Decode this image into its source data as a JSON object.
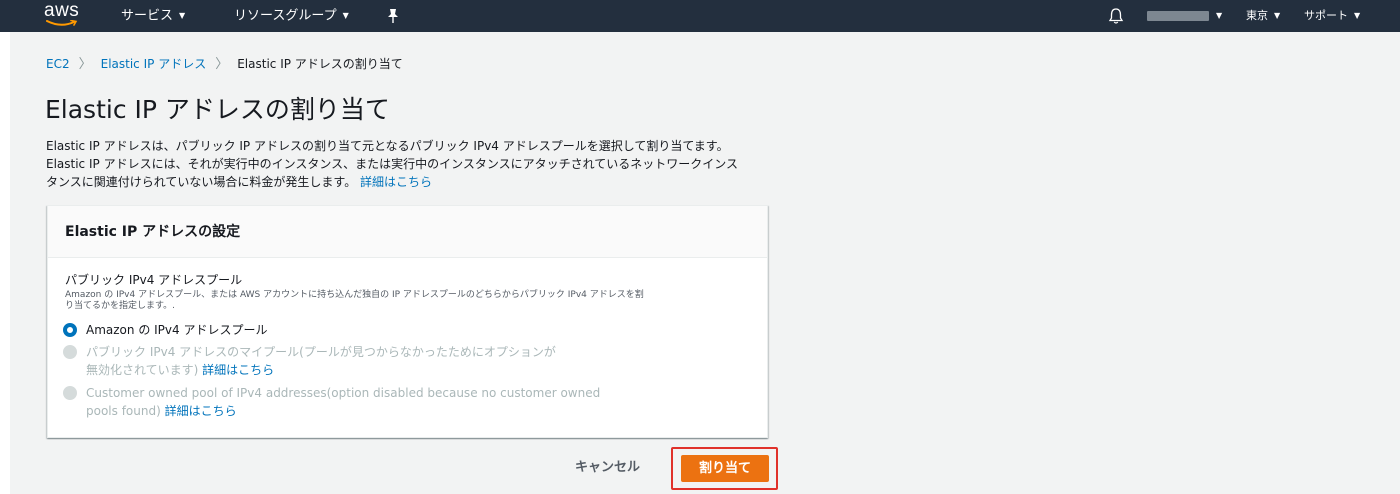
{
  "topnav": {
    "logo_text": "aws",
    "services": "サービス",
    "resource_groups": "リソースグループ",
    "region": "東京",
    "support": "サポート",
    "colors": {
      "background": "#232f3e",
      "text": "#ffffff"
    }
  },
  "breadcrumb": {
    "items": [
      {
        "label": "EC2"
      },
      {
        "label": "Elastic IP アドレス"
      }
    ],
    "current": "Elastic IP アドレスの割り当て"
  },
  "page": {
    "title": "Elastic IP アドレスの割り当て",
    "description": [
      "Elastic IP アドレスは、パブリック IP アドレスの割り当て元となるパブリック IPv4 アドレスプールを選択して割り当てます。",
      "Elastic IP アドレスには、それが実行中のインスタンス、または実行中のインスタンスにアタッチされているネットワークインス",
      "タンスに関連付けられていない場合に料金が発生します。"
    ],
    "description_link": "詳細はこちら"
  },
  "panel": {
    "title": "Elastic IP アドレスの設定",
    "field_label": "パブリック IPv4 アドレスプール",
    "field_description": [
      "Amazon の IPv4 アドレスプール、または AWS アカウントに持ち込んだ独自の IP アドレスプールのどちらからパブリック IPv4 アドレスを割",
      "り当てるかを指定します。."
    ],
    "options": [
      {
        "label": "Amazon の IPv4 アドレスプール",
        "selected": true,
        "disabled": false
      },
      {
        "label_lines": [
          "パブリック IPv4 アドレスのマイプール(プールが見つからなかったためにオプションが",
          "無効化されています)"
        ],
        "link": "詳細はこちら",
        "selected": false,
        "disabled": true
      },
      {
        "label_lines": [
          "Customer owned pool of IPv4 addresses(option disabled because no customer owned",
          "pools found)"
        ],
        "link": "詳細はこちら",
        "selected": false,
        "disabled": true
      }
    ]
  },
  "actions": {
    "cancel": "キャンセル",
    "allocate": "割り当て"
  },
  "colors": {
    "link": "#0073bb",
    "primary_button": "#ec7211",
    "highlight": "#e0312a",
    "page_background": "#f2f3f3"
  }
}
